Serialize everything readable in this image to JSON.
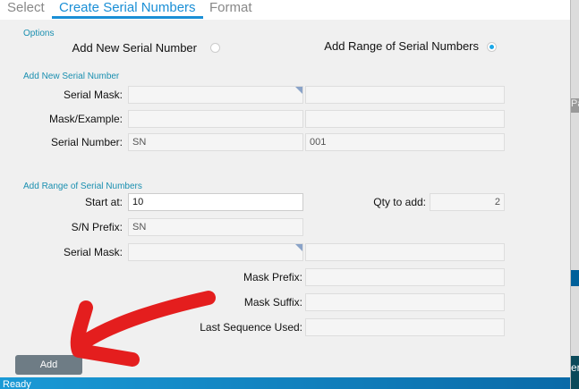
{
  "tabs": [
    {
      "label": "Select"
    },
    {
      "label": "Create Serial Numbers",
      "active": true
    },
    {
      "label": "Format"
    }
  ],
  "options": {
    "title": "Options",
    "add_new": "Add New Serial Number",
    "add_range": "Add Range of Serial Numbers",
    "selected": "add_range"
  },
  "new_section": {
    "title": "Add New Serial Number",
    "serial_mask_label": "Serial Mask:",
    "mask_example_label": "Mask/Example:",
    "serial_number_label": "Serial Number:",
    "serial_number_prefix": "SN",
    "serial_number_value": "001"
  },
  "range_section": {
    "title": "Add Range of Serial Numbers",
    "start_at_label": "Start at:",
    "start_at_value": "10",
    "qty_label": "Qty to add:",
    "qty_value": "2",
    "sn_prefix_label": "S/N Prefix:",
    "sn_prefix_value": "SN",
    "serial_mask_label": "Serial Mask:",
    "mask_prefix_label": "Mask Prefix:",
    "mask_suffix_label": "Mask Suffix:",
    "last_seq_label": "Last Sequence Used:"
  },
  "add_button": "Add",
  "status": "Ready",
  "background": {
    "partial_a": "Pa",
    "partial_b": "er"
  },
  "colors": {
    "accent": "#1a8fd6",
    "arrow": "#e41e1e",
    "button": "#6e7c85"
  }
}
